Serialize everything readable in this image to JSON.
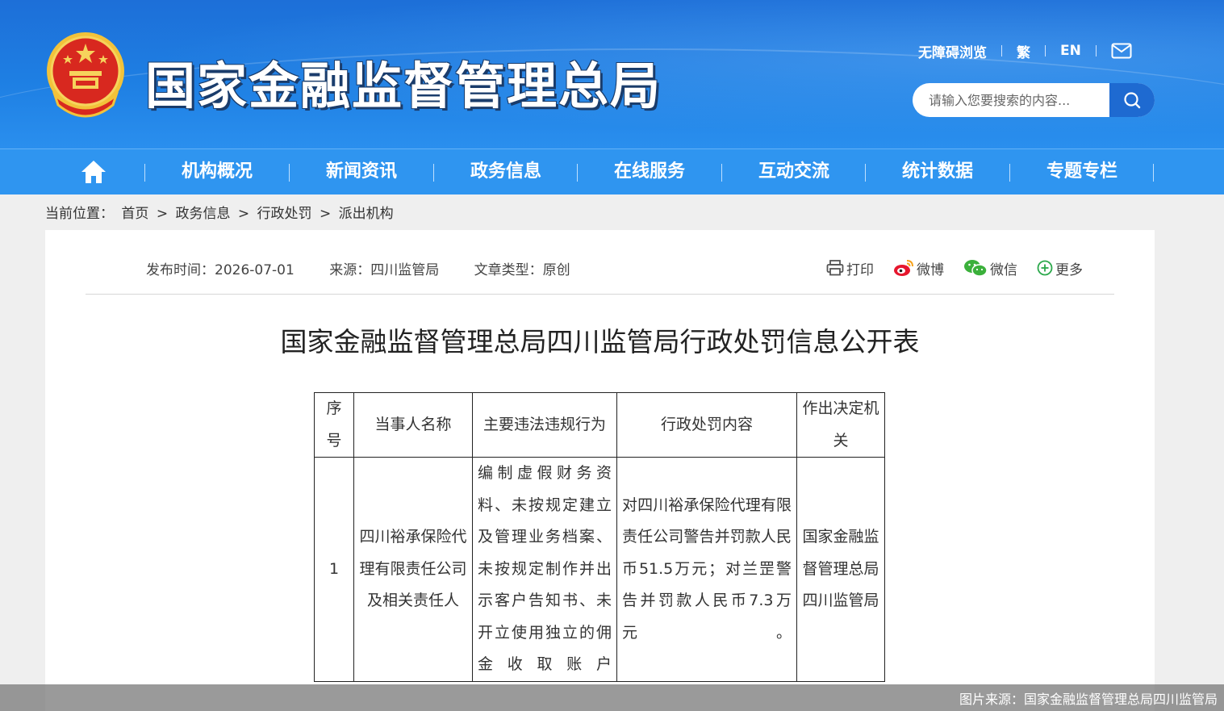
{
  "header": {
    "site_title": "国家金融监督管理总局",
    "links": [
      "无障碍浏览",
      "繁",
      "EN"
    ],
    "search_placeholder": "请输入您要搜索的内容..."
  },
  "nav": {
    "items": [
      "机构概况",
      "新闻资讯",
      "政务信息",
      "在线服务",
      "互动交流",
      "统计数据",
      "专题专栏"
    ]
  },
  "breadcrumb": {
    "label": "当前位置：",
    "items": [
      "首页",
      "政务信息",
      "行政处罚",
      "派出机构"
    ],
    "sep": ">"
  },
  "article": {
    "publish_time": "发布时间：2026-07-01",
    "source": "来源：四川监管局",
    "type": "文章类型：原创",
    "share": [
      "打印",
      "微博",
      "微信",
      "更多"
    ],
    "title": "国家金融监督管理总局四川监管局行政处罚信息公开表"
  },
  "table": {
    "headers": [
      "序号",
      "当事人名称",
      "主要违法违规行为",
      "行政处罚内容",
      "作出决定机关"
    ],
    "rows": [
      {
        "no": "1",
        "party": "四川裕承保险代理有限责任公司及相关责任人",
        "violation": "编制虚假财务资料、未按规定建立及管理业务档案、未按规定制作并出示客户告知书、未开立使用独立的佣金收取账户",
        "penalty": "对四川裕承保险代理有限责任公司警告并罚款人民币51.5万元；对兰罡警告并罚款人民币7.3万元。",
        "authority": "国家金融监督管理总局四川监管局"
      }
    ]
  },
  "footer": {
    "image_source": "图片来源：国家金融监督管理总局四川监管局"
  }
}
